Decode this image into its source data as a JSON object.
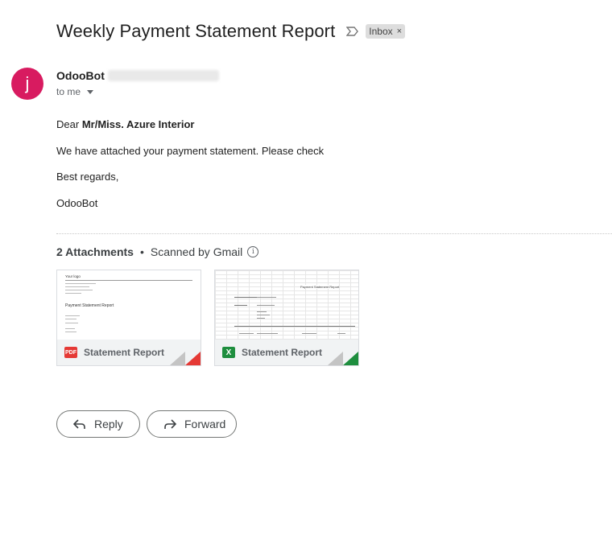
{
  "email": {
    "subject": "Weekly Payment Statement Report",
    "label_chip": "Inbox",
    "label_chip_close": "×",
    "sender_name": "OdooBot",
    "avatar_letter": "j",
    "recipient": "to me",
    "body": {
      "greeting_prefix": "Dear",
      "greeting_name": "Mr/Miss. Azure Interior",
      "line1": "We have attached your payment statement. Please check",
      "line2": "Best regards,",
      "line3": "OdooBot"
    }
  },
  "attachments": {
    "count_label": "2 Attachments",
    "separator": "•",
    "scanned_label": "Scanned by Gmail",
    "info_icon": "i",
    "items": [
      {
        "type_label": "PDF",
        "name": "Statement Report",
        "thumb_logo": "Your logo",
        "thumb_title": "Payment Statement Report",
        "accent": "#e53935"
      },
      {
        "type_label": "X",
        "name": "Statement Report",
        "thumb_title": "Payment Statement Report",
        "accent": "#1e8e3e"
      }
    ]
  },
  "actions": {
    "reply": "Reply",
    "forward": "Forward"
  },
  "colors": {
    "avatar": "#d81b60",
    "chip_bg": "#dddddd"
  }
}
